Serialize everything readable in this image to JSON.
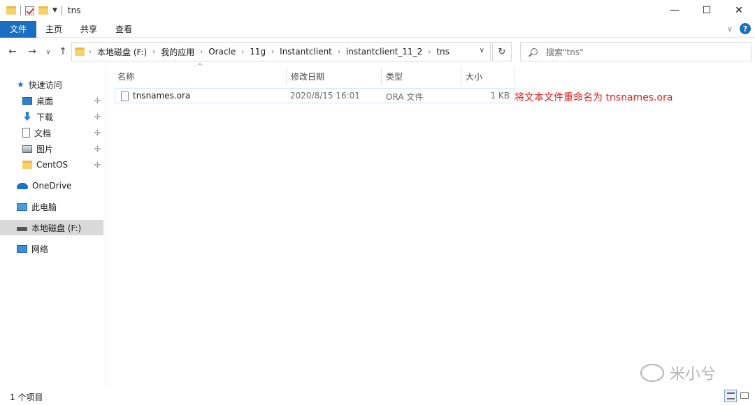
{
  "window": {
    "title": "tns",
    "controls": {
      "minimize": "—",
      "maximize": "☐",
      "close": "✕"
    }
  },
  "ribbon": {
    "tabs": [
      "文件",
      "主页",
      "共享",
      "查看"
    ],
    "collapse_chevron": "∨",
    "help_label": "?"
  },
  "address": {
    "breadcrumbs": [
      "本地磁盘 (F:)",
      "我的应用",
      "Oracle",
      "11g",
      "Instantclient",
      "instantclient_11_2",
      "tns"
    ],
    "search_placeholder": "搜索\"tns\""
  },
  "nav": {
    "quick_access": "快速访问",
    "pinned": [
      {
        "label": "桌面",
        "icon": "desktop-icon"
      },
      {
        "label": "下载",
        "icon": "download-icon"
      },
      {
        "label": "文档",
        "icon": "document-icon"
      },
      {
        "label": "图片",
        "icon": "picture-icon"
      },
      {
        "label": "CentOS",
        "icon": "folder-icon"
      }
    ],
    "onedrive": "OneDrive",
    "this_pc": "此电脑",
    "local_disk": "本地磁盘 (F:)",
    "network": "网络"
  },
  "list": {
    "columns": {
      "name": "名称",
      "modified": "修改日期",
      "type": "类型",
      "size": "大小"
    },
    "files": [
      {
        "name": "tnsnames.ora",
        "modified": "2020/8/15 16:01",
        "type": "ORA 文件",
        "size": "1 KB"
      }
    ],
    "annotation": "将文本文件重命名为 tnsnames.ora"
  },
  "status": {
    "item_count": "1 个项目"
  },
  "watermark": {
    "text": "米小兮"
  }
}
